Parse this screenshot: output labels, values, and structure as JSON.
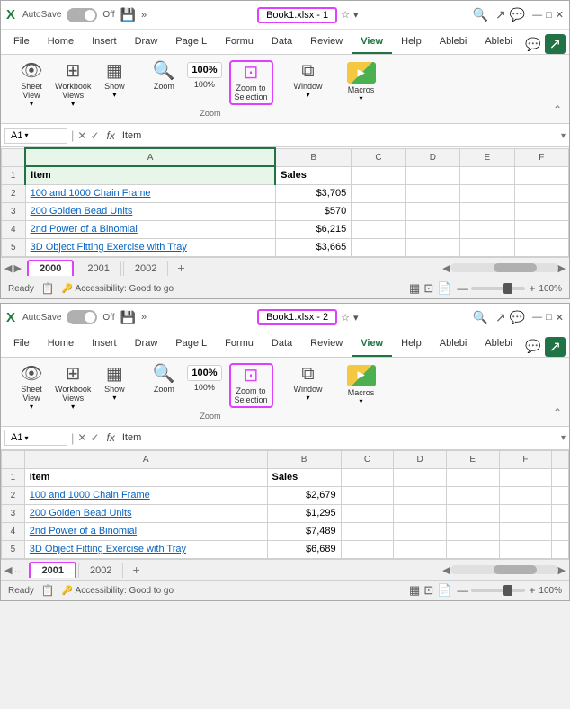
{
  "windows": [
    {
      "id": "window1",
      "title_bar": {
        "app_icon": "X",
        "autosave": "AutoSave",
        "toggle_state": "Off",
        "title": "Book1.xlsx - 1",
        "search_icon": "🔍",
        "controls": [
          "—",
          "□",
          "✕"
        ]
      },
      "ribbon_tabs": [
        "File",
        "Home",
        "Insert",
        "Draw",
        "Page L",
        "Formu",
        "Data",
        "Review",
        "View",
        "Help",
        "Ablebi",
        "Ablebi"
      ],
      "active_tab": "View",
      "ribbon_groups": [
        {
          "label": "",
          "buttons": [
            {
              "id": "sheet-view",
              "icon": "eye",
              "label": "Sheet\nView",
              "has_arrow": true
            },
            {
              "id": "workbook-views",
              "icon": "sheets",
              "label": "Workbook\nViews",
              "has_arrow": true
            },
            {
              "id": "show",
              "icon": "show",
              "label": "Show",
              "has_arrow": true
            }
          ]
        },
        {
          "label": "Zoom",
          "buttons": [
            {
              "id": "zoom",
              "icon": "zoom",
              "label": "Zoom"
            },
            {
              "id": "zoom-100",
              "icon": "100pct",
              "label": "100%"
            },
            {
              "id": "zoom-to-selection",
              "icon": "zoom-sel",
              "label": "Zoom to\nSelection",
              "highlighted": true
            }
          ]
        },
        {
          "label": "",
          "buttons": [
            {
              "id": "window",
              "icon": "window",
              "label": "Window",
              "has_arrow": true
            }
          ]
        },
        {
          "label": "",
          "buttons": [
            {
              "id": "macros",
              "icon": "macros",
              "label": "Macros",
              "has_arrow": true
            }
          ]
        }
      ],
      "formula_bar": {
        "cell_ref": "A1",
        "formula": "Item"
      },
      "columns": [
        "",
        "A",
        "B",
        "C",
        "D",
        "E",
        "F"
      ],
      "rows": [
        {
          "num": "1",
          "cells": [
            "Item",
            "Sales",
            "",
            "",
            "",
            ""
          ]
        },
        {
          "num": "2",
          "cells": [
            "100 and 1000 Chain Frame",
            "$3,705",
            "",
            "",
            "",
            ""
          ]
        },
        {
          "num": "3",
          "cells": [
            "200 Golden Bead Units",
            "$570",
            "",
            "",
            "",
            ""
          ]
        },
        {
          "num": "4",
          "cells": [
            "2nd Power of a Binomial",
            "$6,215",
            "",
            "",
            "",
            ""
          ]
        },
        {
          "num": "5",
          "cells": [
            "3D Object Fitting Exercise with Tray",
            "$3,665",
            "",
            "",
            "",
            ""
          ]
        }
      ],
      "sheet_tabs": [
        "2000",
        "2001",
        "2002"
      ],
      "active_sheet": "2000",
      "zoom": "100%",
      "status": "Ready",
      "accessibility": "Accessibility: Good to go"
    },
    {
      "id": "window2",
      "title_bar": {
        "app_icon": "X",
        "autosave": "AutoSave",
        "toggle_state": "Off",
        "title": "Book1.xlsx - 2",
        "search_icon": "🔍",
        "controls": [
          "—",
          "□",
          "✕"
        ]
      },
      "ribbon_tabs": [
        "File",
        "Home",
        "Insert",
        "Draw",
        "Page L",
        "Formu",
        "Data",
        "Review",
        "View",
        "Help",
        "Ablebi",
        "Ablebi"
      ],
      "active_tab": "View",
      "ribbon_groups": [
        {
          "label": "",
          "buttons": [
            {
              "id": "sheet-view",
              "icon": "eye",
              "label": "Sheet\nView",
              "has_arrow": true
            },
            {
              "id": "workbook-views",
              "icon": "sheets",
              "label": "Workbook\nViews",
              "has_arrow": true
            },
            {
              "id": "show",
              "icon": "show",
              "label": "Show",
              "has_arrow": true
            }
          ]
        },
        {
          "label": "Zoom",
          "buttons": [
            {
              "id": "zoom",
              "icon": "zoom",
              "label": "Zoom"
            },
            {
              "id": "zoom-100",
              "icon": "100pct",
              "label": "100%"
            },
            {
              "id": "zoom-to-selection",
              "icon": "zoom-sel",
              "label": "Zoom to\nSelection",
              "highlighted": true
            }
          ]
        },
        {
          "label": "",
          "buttons": [
            {
              "id": "window",
              "icon": "window",
              "label": "Window",
              "has_arrow": true
            }
          ]
        },
        {
          "label": "",
          "buttons": [
            {
              "id": "macros",
              "icon": "macros",
              "label": "Macros",
              "has_arrow": true
            }
          ]
        }
      ],
      "formula_bar": {
        "cell_ref": "A1",
        "formula": "Item"
      },
      "columns": [
        "",
        "A",
        "B",
        "C",
        "D",
        "E",
        "F",
        ""
      ],
      "rows": [
        {
          "num": "1",
          "cells": [
            "Item",
            "Sales",
            "",
            "",
            "",
            ""
          ]
        },
        {
          "num": "2",
          "cells": [
            "100 and 1000 Chain Frame",
            "$2,679",
            "",
            "",
            "",
            ""
          ]
        },
        {
          "num": "3",
          "cells": [
            "200 Golden Bead Units",
            "$1,295",
            "",
            "",
            "",
            ""
          ]
        },
        {
          "num": "4",
          "cells": [
            "2nd Power of a Binomial",
            "$7,489",
            "",
            "",
            "",
            ""
          ]
        },
        {
          "num": "5",
          "cells": [
            "3D Object Fitting Exercise with Tray",
            "$6,689",
            "",
            "",
            "",
            ""
          ]
        }
      ],
      "sheet_tabs": [
        "2001",
        "2002"
      ],
      "active_sheet": "2001",
      "zoom": "100%",
      "status": "Ready",
      "accessibility": "Accessibility: Good to go",
      "has_back_nav": true
    }
  ]
}
